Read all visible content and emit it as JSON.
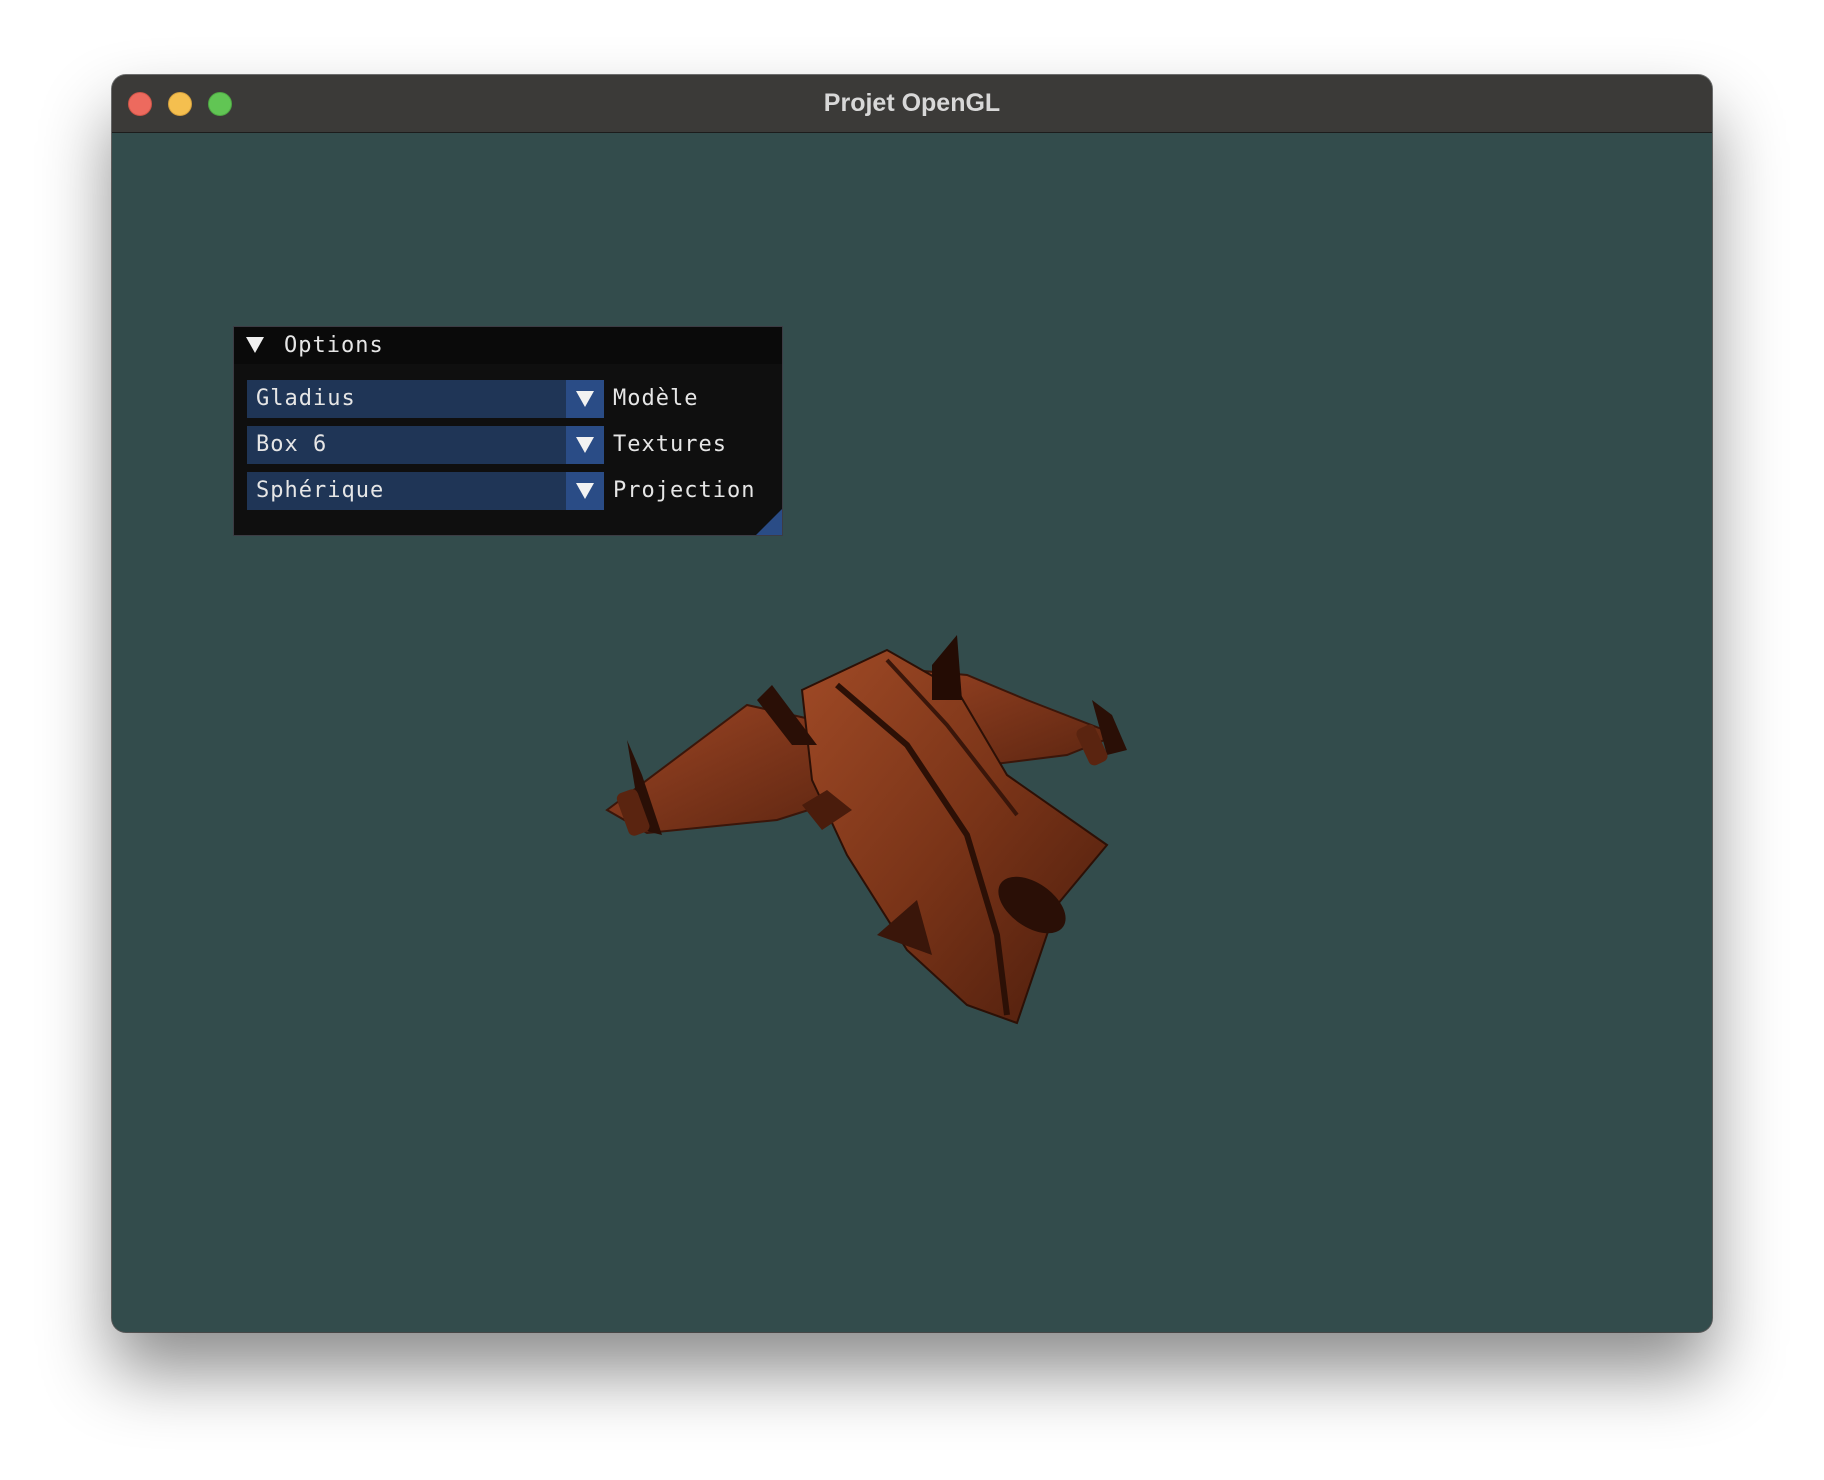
{
  "window": {
    "title": "Projet OpenGL"
  },
  "options_panel": {
    "title": "Options",
    "rows": [
      {
        "value": "Gladius",
        "label": "Modèle"
      },
      {
        "value": "Box 6",
        "label": "Textures"
      },
      {
        "value": "Sphérique",
        "label": "Projection"
      }
    ]
  },
  "colors": {
    "background": "#334c4c",
    "combo_bg": "#1f3556",
    "combo_button": "#2a4c86",
    "model_tint": "#8a3a1c"
  },
  "icons": {
    "close": "close-icon",
    "minimize": "minimize-icon",
    "maximize": "maximize-icon",
    "collapse": "collapse-arrow-icon",
    "dropdown": "chevron-down-icon"
  }
}
